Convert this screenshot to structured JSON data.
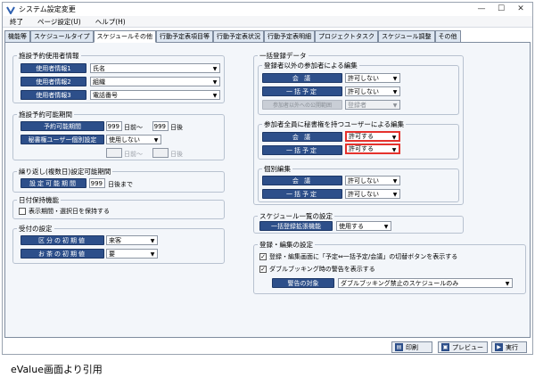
{
  "window": {
    "title": "システム設定変更",
    "minimize": "—",
    "maximize": "☐",
    "close": "✕"
  },
  "menu": [
    "終了",
    "ページ設定(U)",
    "ヘルプ(H)"
  ],
  "tabs": [
    "機能等",
    "スケジュールタイプ",
    "スケジュールその他",
    "行動予定表項目等",
    "行動予定表状況",
    "行動予定表明細",
    "プロジェクトタスク",
    "スケジュール調整",
    "その他"
  ],
  "left": {
    "facility": {
      "title": "施設予約使用者情報",
      "rows": [
        {
          "label": "使用者情報1",
          "value": "氏名"
        },
        {
          "label": "使用者情報2",
          "value": "組織"
        },
        {
          "label": "使用者情報3",
          "value": "電話番号"
        }
      ]
    },
    "period": {
      "title": "施設予約可能期間",
      "label1": "予約可能期間",
      "before_val": "999",
      "before_txt": "日前～",
      "after_val": "999",
      "after_txt": "日後",
      "label2": "秘書権ユーザー個別設定",
      "secretary_value": "使用しない",
      "d_before_txt": "日前～",
      "d_after_txt": "日後"
    },
    "repeat": {
      "title": "繰り返し(複数日)設定可能期間",
      "label": "設定可能期間",
      "value": "999",
      "unit": "日後まで"
    },
    "keep": {
      "title": "日付保持機能",
      "checkbox": "表示期間・選択日を保持する"
    },
    "reception": {
      "title": "受付の設定",
      "rows": [
        {
          "label": "区分の初期値",
          "value": "来客"
        },
        {
          "label": "お茶の初期値",
          "value": "要"
        }
      ]
    }
  },
  "right": {
    "bulk": {
      "title": "一括登録データ",
      "sec1": {
        "title": "登録者以外の参加者による編集",
        "rows": [
          {
            "label": "会 議",
            "value": "許可しない"
          },
          {
            "label": "一括予定",
            "value": "許可しない"
          },
          {
            "label": "参加者以外への公開範囲",
            "value": "登録者"
          }
        ]
      },
      "sec2": {
        "title": "参加者全員に秘書権を持つユーザーによる編集",
        "rows": [
          {
            "label": "会 議",
            "value": "許可する"
          },
          {
            "label": "一括予定",
            "value": "許可する"
          }
        ]
      },
      "sec3": {
        "title": "個別編集",
        "rows": [
          {
            "label": "会 議",
            "value": "許可しない"
          },
          {
            "label": "一括予定",
            "value": "許可しない"
          }
        ]
      }
    },
    "list": {
      "title": "スケジュール一覧の設定",
      "label": "一括登録拡張機能",
      "value": "使用する"
    },
    "edit": {
      "title": "登録・編集の設定",
      "check1": "登録・編集画面に「予定⇔一括予定/会議」の切替ボタンを表示する",
      "check2": "ダブルブッキング時の警告を表示する",
      "warn_label": "警告の対象",
      "warn_value": "ダブルブッキング禁止のスケジュールのみ"
    }
  },
  "footer": {
    "print": "印刷",
    "preview": "プレビュー",
    "run": "実行"
  },
  "caption": "eValue画面より引用"
}
